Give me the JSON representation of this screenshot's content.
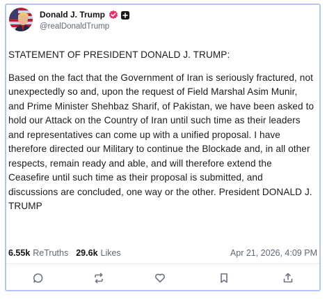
{
  "post": {
    "author_name": "Donald J. Trump",
    "author_handle": "@realDonaldTrump",
    "title_line": "STATEMENT OF PRESIDENT DONALD J. TRUMP:",
    "body": "Based on the fact that the Government of Iran is seriously fractured, not unexpectedly so and, upon the request of Field Marshal Asim Munir, and Prime Minister Shehbaz Sharif, of Pakistan, we have been asked to hold our Attack on the Country of Iran until such time as their leaders and representatives can come up with a unified proposal. I have therefore directed our Military to continue the Blockade and, in all other respects, remain ready and able, and will therefore extend the Ceasefire until such time as their proposal is submitted, and discussions are concluded, one way or the other. President DONALD J. TRUMP",
    "retruths_count": "6.55k",
    "retruths_label": "ReTruths",
    "likes_count": "29.6k",
    "likes_label": "Likes",
    "timestamp": "Apr 21, 2026, 4:09 PM"
  },
  "actions": [
    {
      "icon": "reply-icon"
    },
    {
      "icon": "retruth-icon"
    },
    {
      "icon": "like-icon"
    },
    {
      "icon": "bookmark-icon"
    },
    {
      "icon": "share-icon"
    }
  ],
  "colors": {
    "border": "#b8c4ef",
    "verified": "#e0336c",
    "muted_text": "#5f6775"
  }
}
